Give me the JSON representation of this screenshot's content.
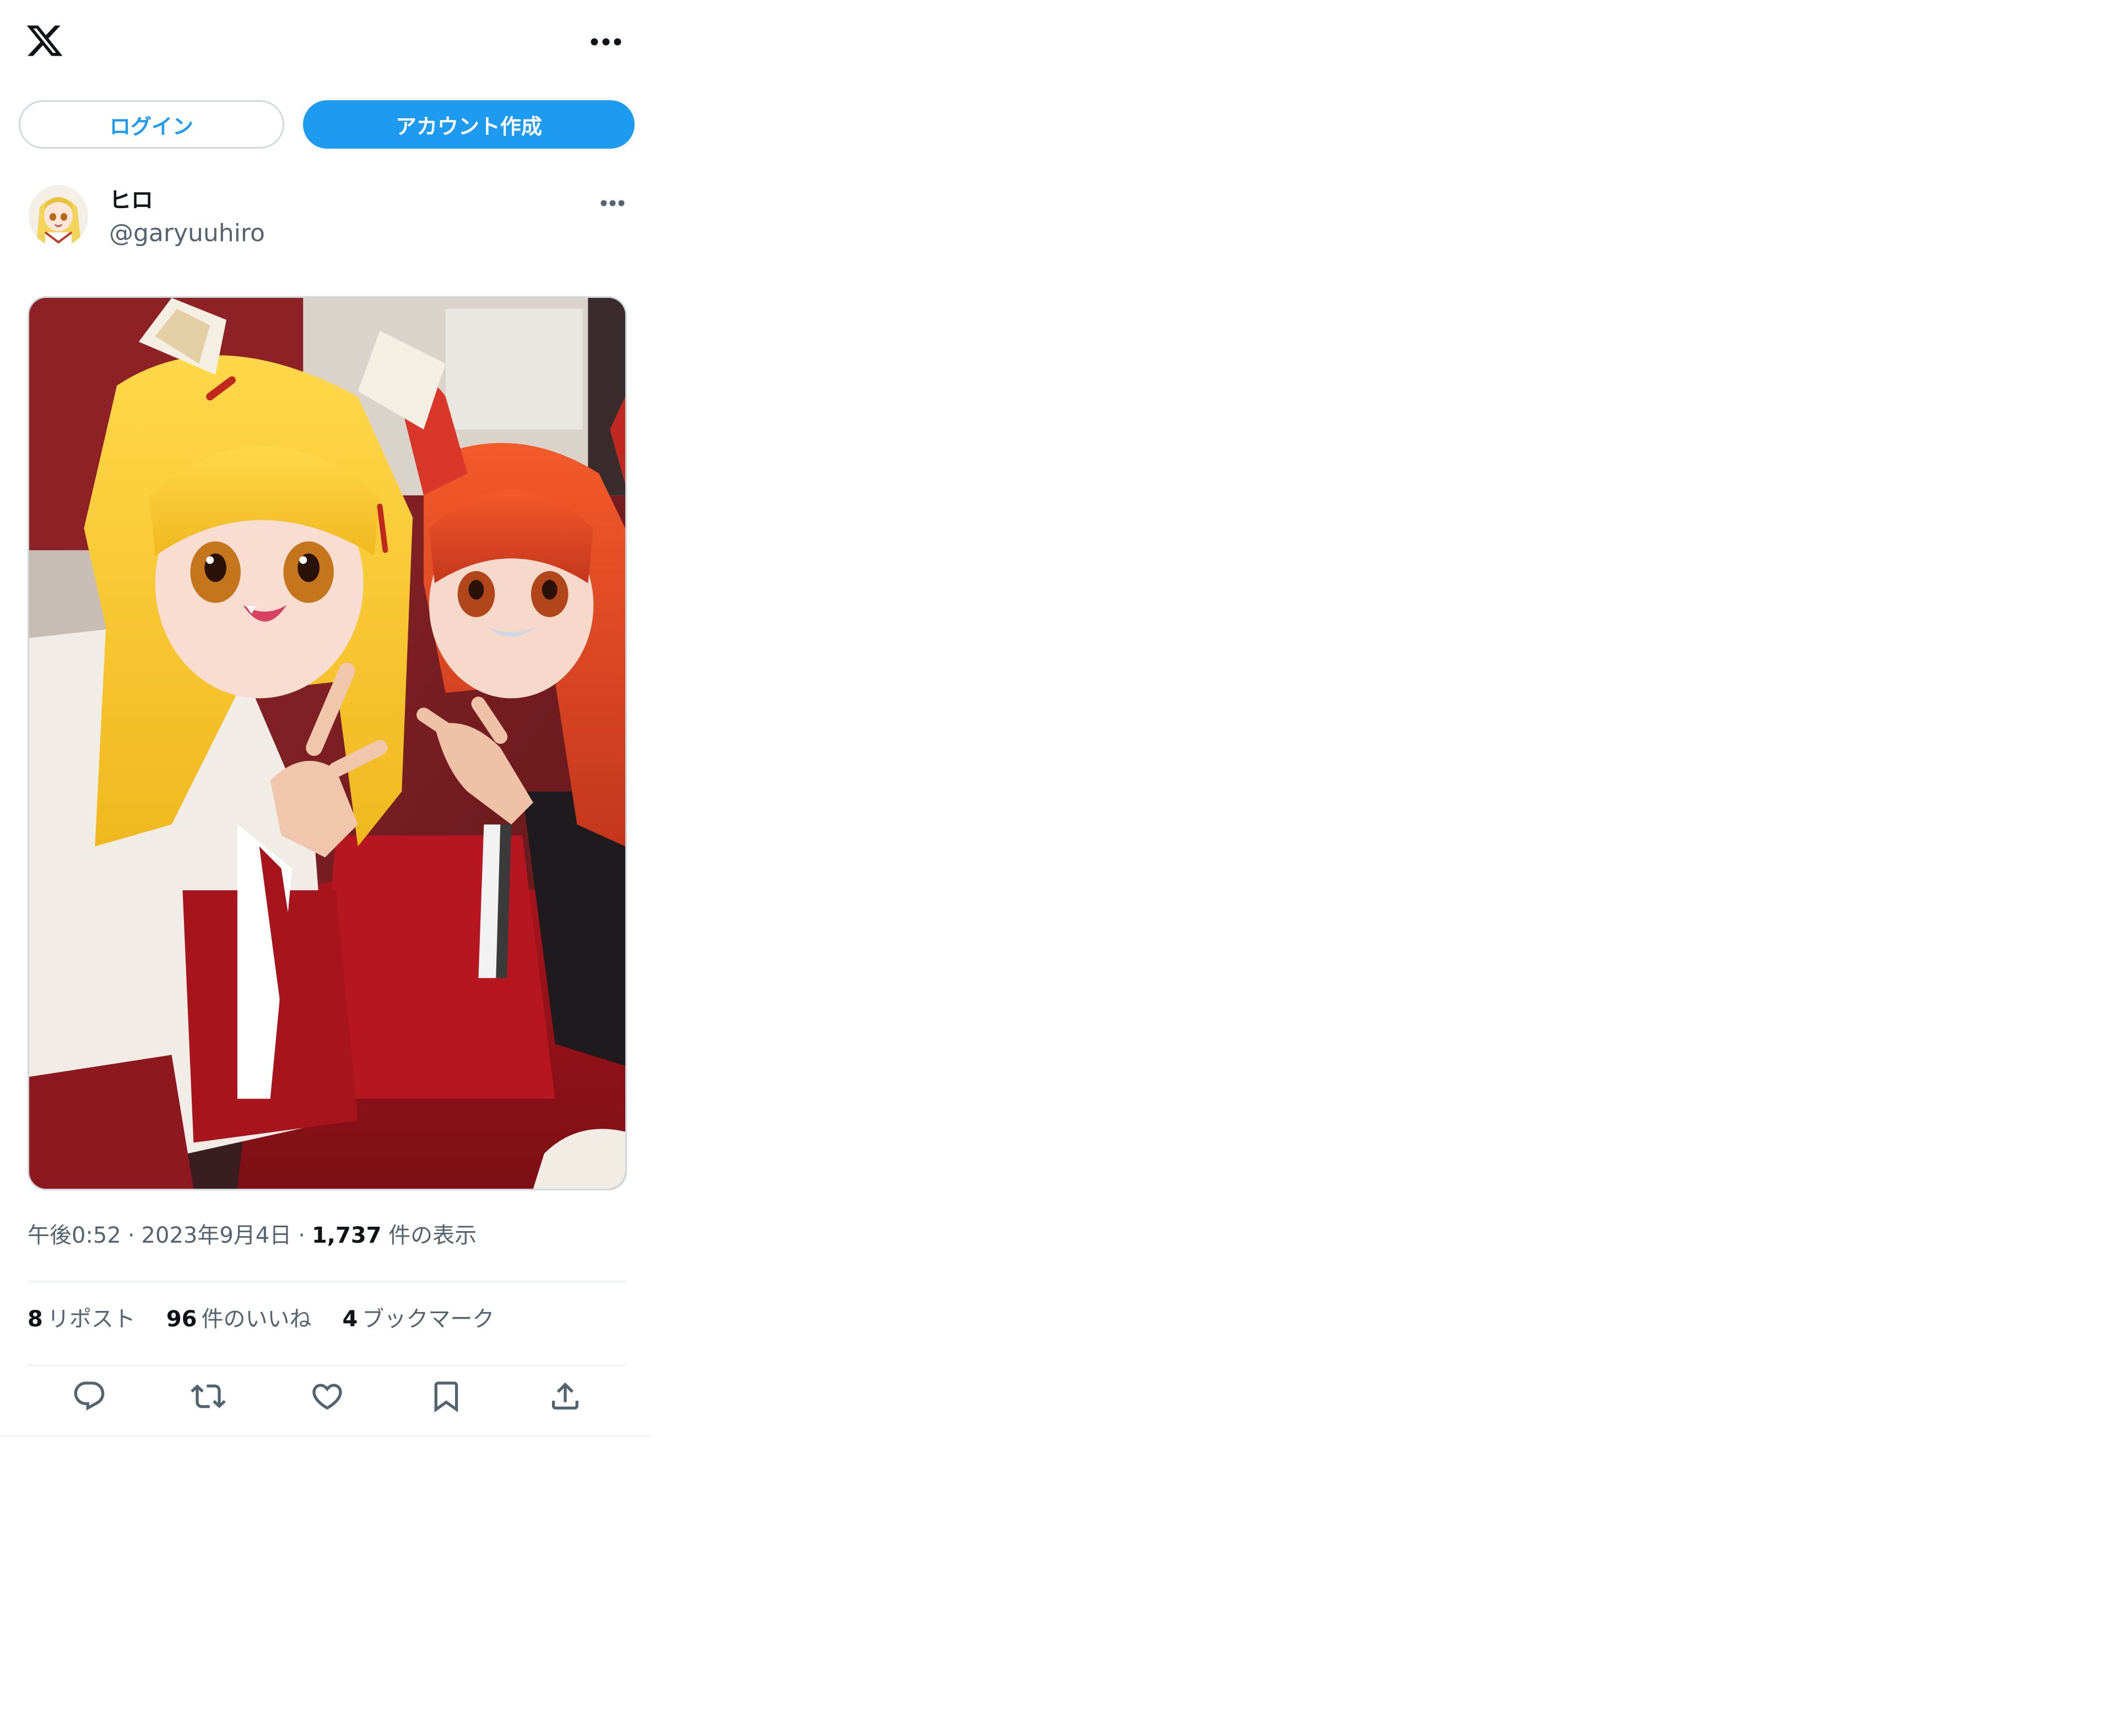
{
  "header": {
    "logo_icon": "x-logo-icon",
    "more_icon": "more-icon"
  },
  "auth": {
    "login_label": "ログイン",
    "signup_label": "アカウント作成",
    "accent_color": "#1d9bf0"
  },
  "tweet": {
    "author": {
      "name": "ヒロ",
      "handle": "@garyuuhiro"
    },
    "meta": {
      "time": "午後0:52",
      "date": "2023年9月4日",
      "separator": "·",
      "views_count": "1,737",
      "views_label": "件の表示"
    },
    "stats": {
      "reposts_count": "8",
      "reposts_label": "リポスト",
      "likes_count": "96",
      "likes_label": "件のいいね",
      "bookmarks_count": "4",
      "bookmarks_label": "ブックマーク"
    },
    "actions": [
      "reply-icon",
      "repost-icon",
      "like-icon",
      "bookmark-icon",
      "share-icon"
    ]
  }
}
